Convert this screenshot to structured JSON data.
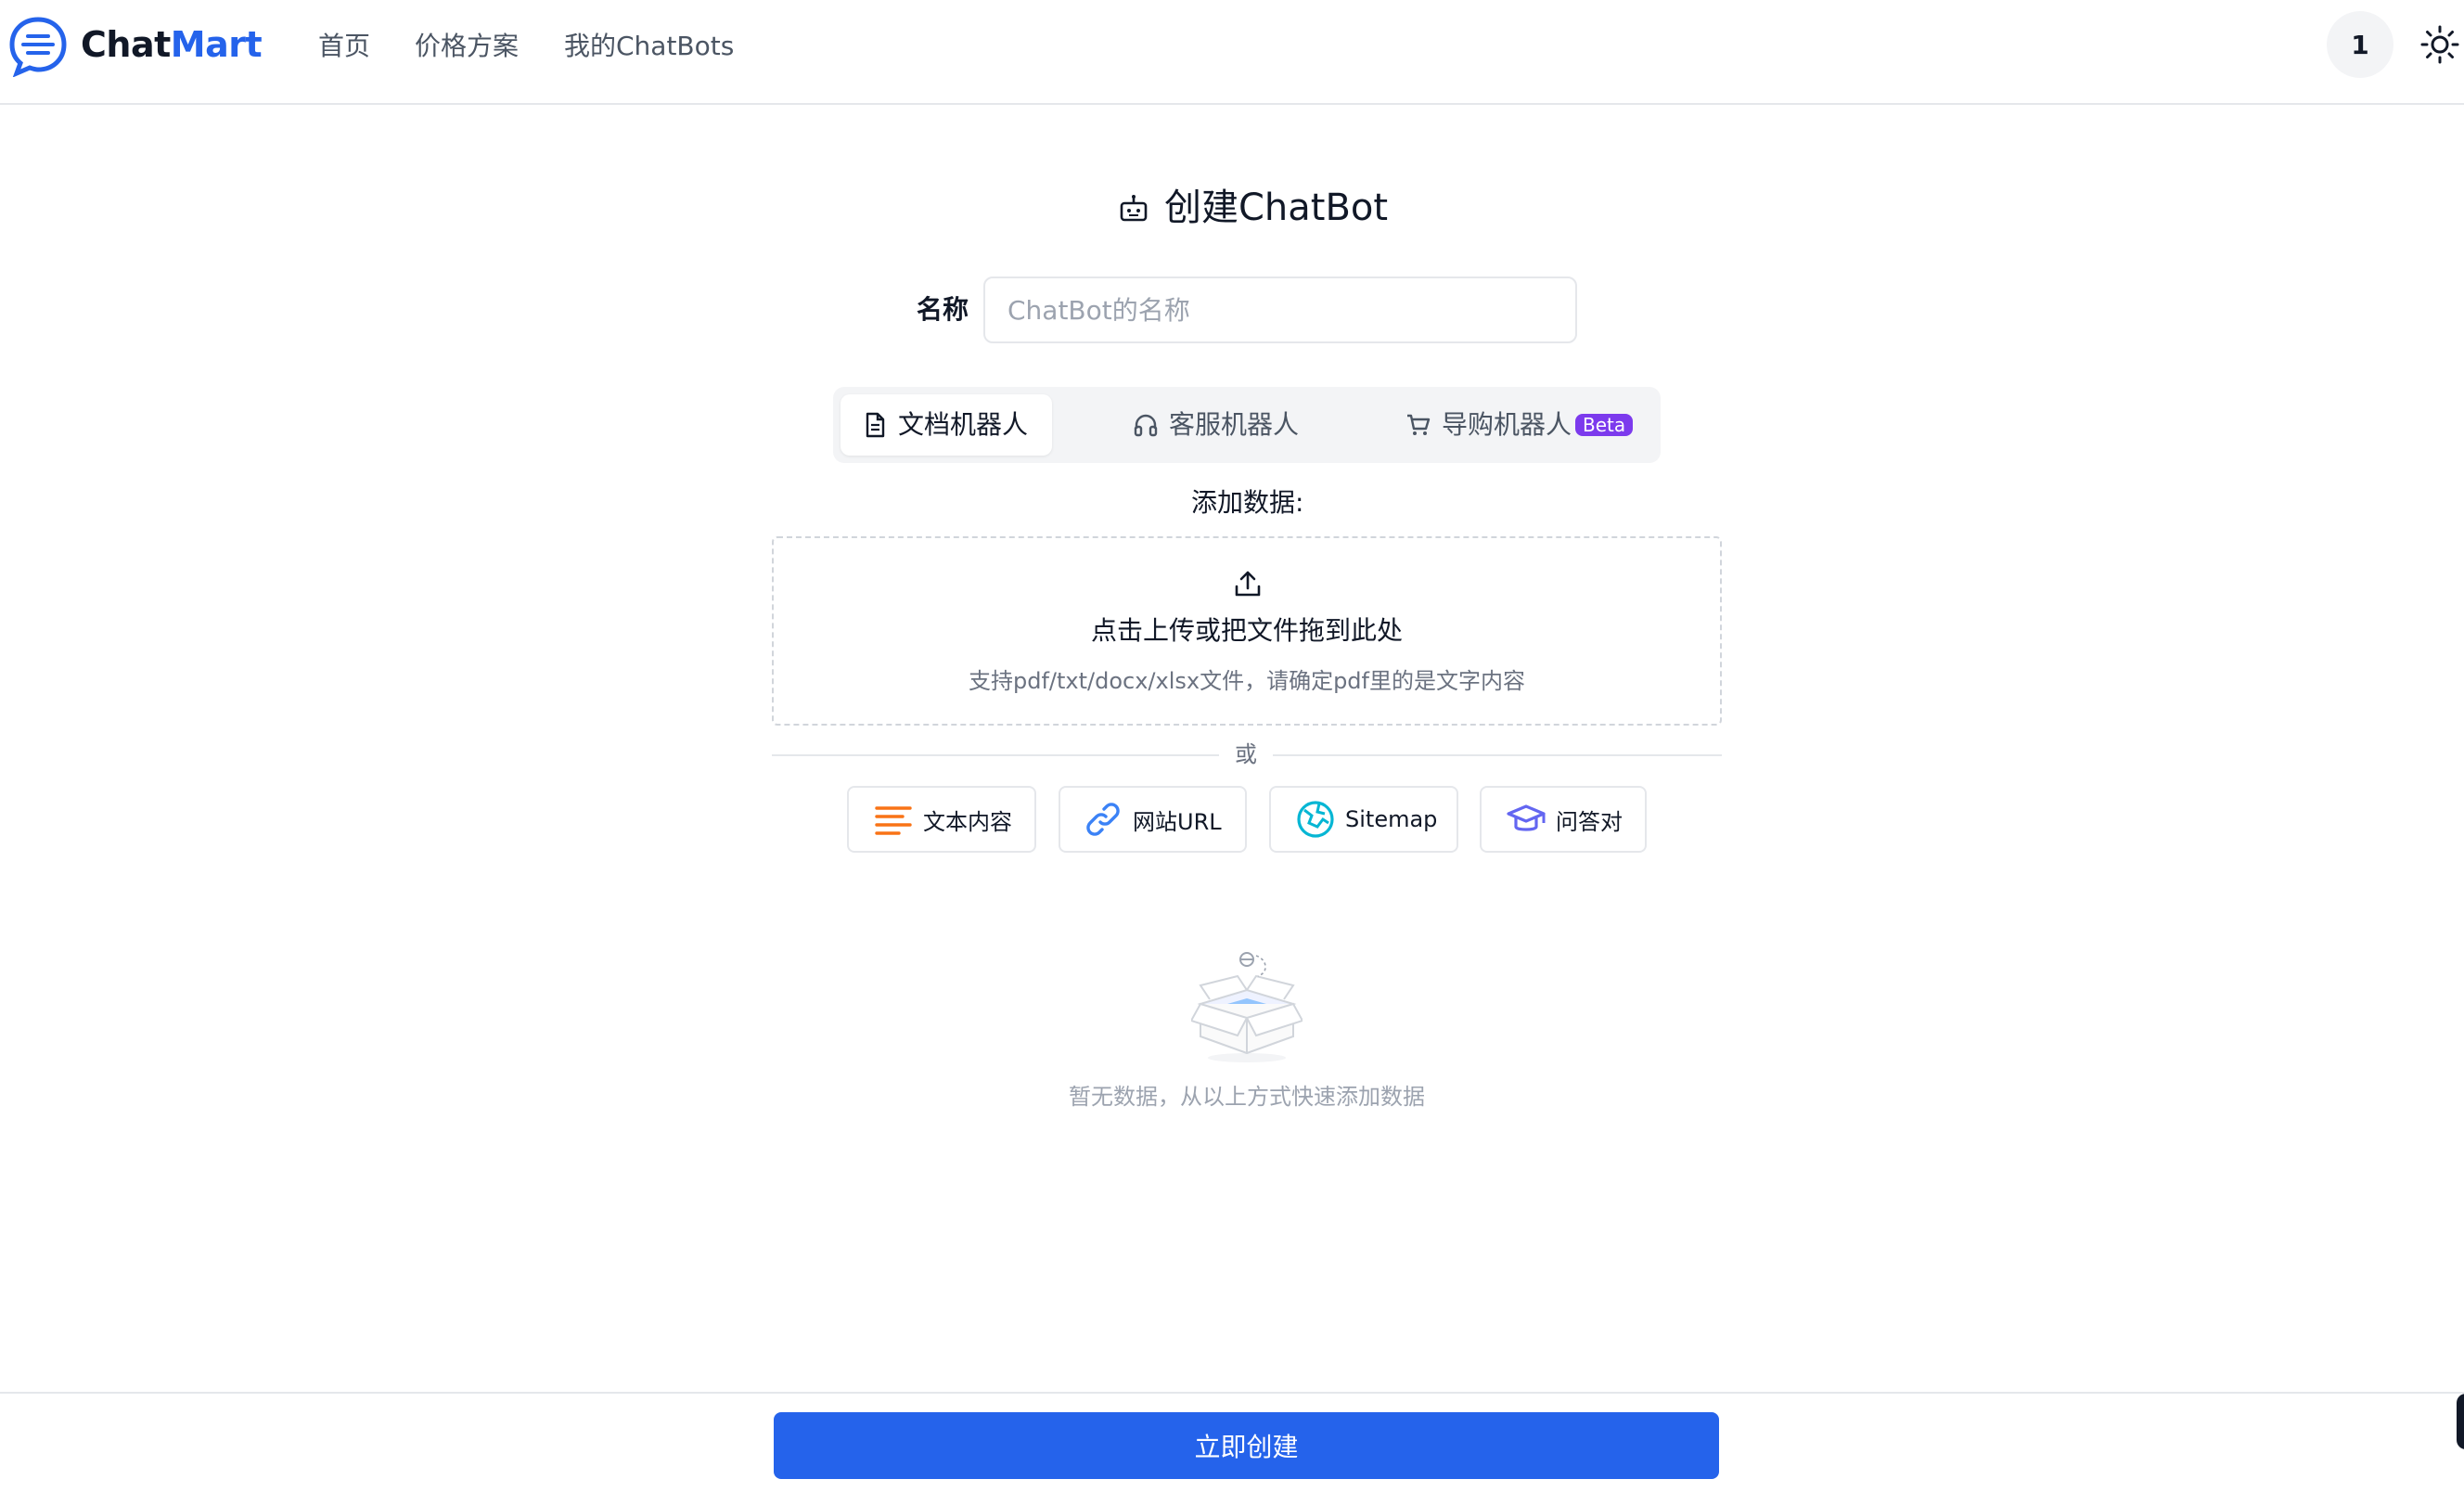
{
  "header": {
    "brand_part1": "Chat",
    "brand_part2": "Mart",
    "nav": {
      "home": "首页",
      "pricing": "价格方案",
      "mybots": "我的ChatBots"
    },
    "avatar_label": "1",
    "theme_icon": "sun-icon"
  },
  "page": {
    "title": "创建ChatBot",
    "title_icon": "robot-icon"
  },
  "name_field": {
    "label": "名称",
    "placeholder": "ChatBot的名称",
    "value": ""
  },
  "tabs": [
    {
      "label": "文档机器人",
      "icon": "document-icon",
      "selected": true
    },
    {
      "label": "客服机器人",
      "icon": "headphones-icon",
      "selected": false
    },
    {
      "label": "导购机器人",
      "icon": "cart-icon",
      "selected": false,
      "badge": "Beta"
    }
  ],
  "add_data": {
    "label": "添加数据:",
    "upload_main": "点击上传或把文件拖到此处",
    "upload_hint": "支持pdf/txt/docx/xlsx文件，请确定pdf里的是文字内容",
    "or": "或"
  },
  "sources": [
    {
      "label": "文本内容",
      "icon": "text-lines-icon"
    },
    {
      "label": "网站URL",
      "icon": "link-icon"
    },
    {
      "label": "Sitemap",
      "icon": "sitemap-icon"
    },
    {
      "label": "问答对",
      "icon": "graduation-cap-icon"
    }
  ],
  "empty": {
    "text": "暂无数据，从以上方式快速添加数据"
  },
  "footer": {
    "create_label": "立即创建"
  },
  "colors": {
    "accent": "#2563eb",
    "beta": "#7c3aed",
    "text_icon": "#f97316",
    "link_icon": "#3b82f6",
    "sitemap_icon": "#06b6d4",
    "qa_icon": "#6366f1"
  }
}
